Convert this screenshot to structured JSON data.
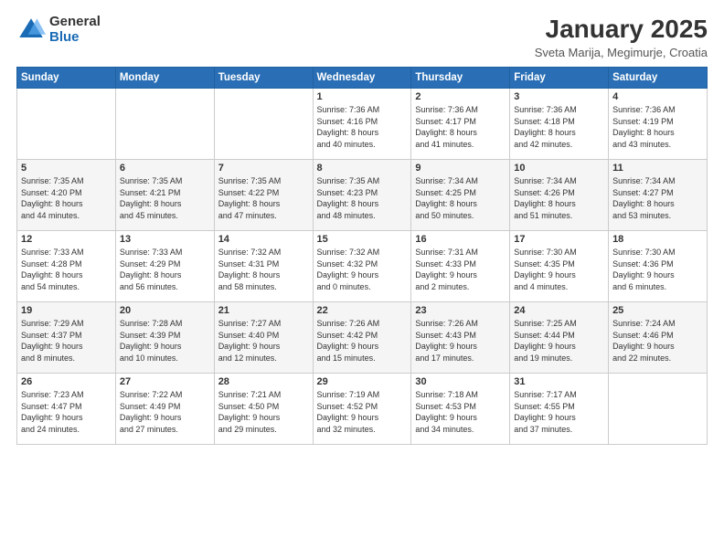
{
  "logo": {
    "general": "General",
    "blue": "Blue"
  },
  "header": {
    "title": "January 2025",
    "subtitle": "Sveta Marija, Megimurje, Croatia"
  },
  "weekdays": [
    "Sunday",
    "Monday",
    "Tuesday",
    "Wednesday",
    "Thursday",
    "Friday",
    "Saturday"
  ],
  "weeks": [
    [
      {
        "day": "",
        "info": ""
      },
      {
        "day": "",
        "info": ""
      },
      {
        "day": "",
        "info": ""
      },
      {
        "day": "1",
        "info": "Sunrise: 7:36 AM\nSunset: 4:16 PM\nDaylight: 8 hours\nand 40 minutes."
      },
      {
        "day": "2",
        "info": "Sunrise: 7:36 AM\nSunset: 4:17 PM\nDaylight: 8 hours\nand 41 minutes."
      },
      {
        "day": "3",
        "info": "Sunrise: 7:36 AM\nSunset: 4:18 PM\nDaylight: 8 hours\nand 42 minutes."
      },
      {
        "day": "4",
        "info": "Sunrise: 7:36 AM\nSunset: 4:19 PM\nDaylight: 8 hours\nand 43 minutes."
      }
    ],
    [
      {
        "day": "5",
        "info": "Sunrise: 7:35 AM\nSunset: 4:20 PM\nDaylight: 8 hours\nand 44 minutes."
      },
      {
        "day": "6",
        "info": "Sunrise: 7:35 AM\nSunset: 4:21 PM\nDaylight: 8 hours\nand 45 minutes."
      },
      {
        "day": "7",
        "info": "Sunrise: 7:35 AM\nSunset: 4:22 PM\nDaylight: 8 hours\nand 47 minutes."
      },
      {
        "day": "8",
        "info": "Sunrise: 7:35 AM\nSunset: 4:23 PM\nDaylight: 8 hours\nand 48 minutes."
      },
      {
        "day": "9",
        "info": "Sunrise: 7:34 AM\nSunset: 4:25 PM\nDaylight: 8 hours\nand 50 minutes."
      },
      {
        "day": "10",
        "info": "Sunrise: 7:34 AM\nSunset: 4:26 PM\nDaylight: 8 hours\nand 51 minutes."
      },
      {
        "day": "11",
        "info": "Sunrise: 7:34 AM\nSunset: 4:27 PM\nDaylight: 8 hours\nand 53 minutes."
      }
    ],
    [
      {
        "day": "12",
        "info": "Sunrise: 7:33 AM\nSunset: 4:28 PM\nDaylight: 8 hours\nand 54 minutes."
      },
      {
        "day": "13",
        "info": "Sunrise: 7:33 AM\nSunset: 4:29 PM\nDaylight: 8 hours\nand 56 minutes."
      },
      {
        "day": "14",
        "info": "Sunrise: 7:32 AM\nSunset: 4:31 PM\nDaylight: 8 hours\nand 58 minutes."
      },
      {
        "day": "15",
        "info": "Sunrise: 7:32 AM\nSunset: 4:32 PM\nDaylight: 9 hours\nand 0 minutes."
      },
      {
        "day": "16",
        "info": "Sunrise: 7:31 AM\nSunset: 4:33 PM\nDaylight: 9 hours\nand 2 minutes."
      },
      {
        "day": "17",
        "info": "Sunrise: 7:30 AM\nSunset: 4:35 PM\nDaylight: 9 hours\nand 4 minutes."
      },
      {
        "day": "18",
        "info": "Sunrise: 7:30 AM\nSunset: 4:36 PM\nDaylight: 9 hours\nand 6 minutes."
      }
    ],
    [
      {
        "day": "19",
        "info": "Sunrise: 7:29 AM\nSunset: 4:37 PM\nDaylight: 9 hours\nand 8 minutes."
      },
      {
        "day": "20",
        "info": "Sunrise: 7:28 AM\nSunset: 4:39 PM\nDaylight: 9 hours\nand 10 minutes."
      },
      {
        "day": "21",
        "info": "Sunrise: 7:27 AM\nSunset: 4:40 PM\nDaylight: 9 hours\nand 12 minutes."
      },
      {
        "day": "22",
        "info": "Sunrise: 7:26 AM\nSunset: 4:42 PM\nDaylight: 9 hours\nand 15 minutes."
      },
      {
        "day": "23",
        "info": "Sunrise: 7:26 AM\nSunset: 4:43 PM\nDaylight: 9 hours\nand 17 minutes."
      },
      {
        "day": "24",
        "info": "Sunrise: 7:25 AM\nSunset: 4:44 PM\nDaylight: 9 hours\nand 19 minutes."
      },
      {
        "day": "25",
        "info": "Sunrise: 7:24 AM\nSunset: 4:46 PM\nDaylight: 9 hours\nand 22 minutes."
      }
    ],
    [
      {
        "day": "26",
        "info": "Sunrise: 7:23 AM\nSunset: 4:47 PM\nDaylight: 9 hours\nand 24 minutes."
      },
      {
        "day": "27",
        "info": "Sunrise: 7:22 AM\nSunset: 4:49 PM\nDaylight: 9 hours\nand 27 minutes."
      },
      {
        "day": "28",
        "info": "Sunrise: 7:21 AM\nSunset: 4:50 PM\nDaylight: 9 hours\nand 29 minutes."
      },
      {
        "day": "29",
        "info": "Sunrise: 7:19 AM\nSunset: 4:52 PM\nDaylight: 9 hours\nand 32 minutes."
      },
      {
        "day": "30",
        "info": "Sunrise: 7:18 AM\nSunset: 4:53 PM\nDaylight: 9 hours\nand 34 minutes."
      },
      {
        "day": "31",
        "info": "Sunrise: 7:17 AM\nSunset: 4:55 PM\nDaylight: 9 hours\nand 37 minutes."
      },
      {
        "day": "",
        "info": ""
      }
    ]
  ]
}
